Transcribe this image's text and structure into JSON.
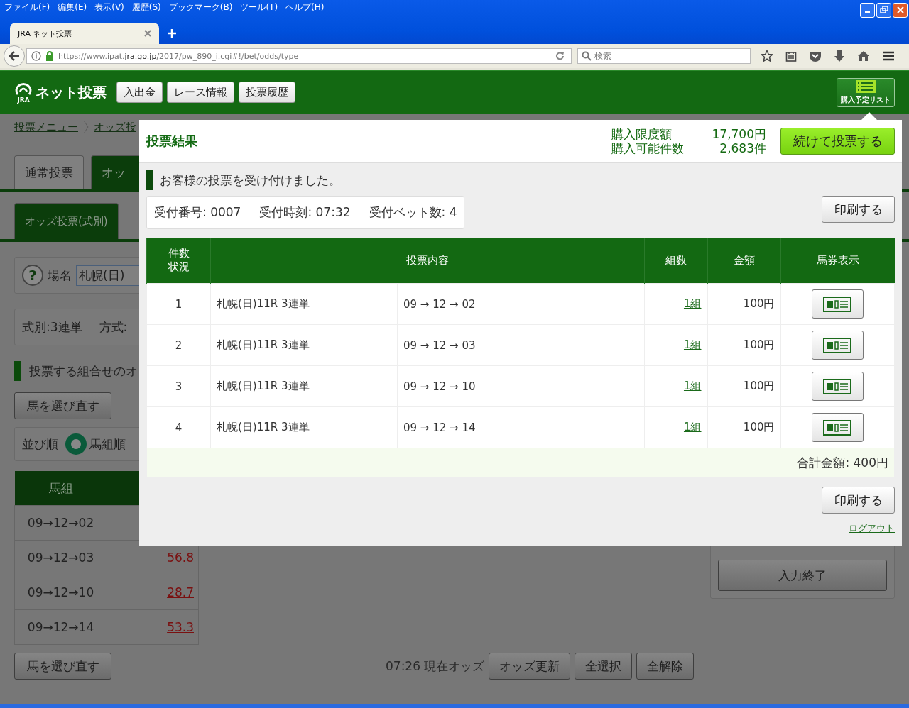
{
  "browser": {
    "menu": [
      "ファイル(F)",
      "編集(E)",
      "表示(V)",
      "履歴(S)",
      "ブックマーク(B)",
      "ツール(T)",
      "ヘルプ(H)"
    ],
    "tab_title": "JRA  ネット投票",
    "url": "https://www.ipat.**jra.go.jp**/2017/pw_890_i.cgi#!/bet/odds/type",
    "search_placeholder": "検索"
  },
  "site_header": {
    "logo_mark": "JRA",
    "logo_text": "ネット投票",
    "nav": [
      "入出金",
      "レース情報",
      "投票履歴"
    ],
    "list_button": "購入予定リスト"
  },
  "background": {
    "breadcrumb": [
      "投票メニュー",
      "オッズ投"
    ],
    "tabs": [
      {
        "label": "通常投票",
        "selected": false
      },
      {
        "label": "オッ",
        "selected": true
      }
    ],
    "subtabs": [
      {
        "label": "オッズ投票(式別)",
        "selected": true
      }
    ],
    "help_icon": "?",
    "venue": {
      "label": "場名",
      "value": "札幌(日)"
    },
    "bet_info": [
      "式別:3連単",
      "方式:"
    ],
    "section_title": "投票する組合せのオ",
    "reselect_button": "馬を選び直す",
    "sort": {
      "label": "並び順",
      "options": [
        {
          "label": "馬組順",
          "selected": true
        }
      ]
    },
    "odds_table": {
      "columns": [
        "馬組"
      ],
      "rows": [
        {
          "combo": "09→12→02"
        },
        {
          "combo": "09→12→03",
          "odds": "56.8"
        },
        {
          "combo": "09→12→10",
          "odds": "28.7"
        },
        {
          "combo": "09→12→14",
          "odds": "53.3"
        }
      ]
    },
    "reselect_button_bottom": "馬を選び直す",
    "odds_time": "07:26 現在オッズ",
    "odds_buttons": [
      "オッズ更新",
      "全選択",
      "全解除"
    ],
    "finish_button": "入力終了"
  },
  "modal": {
    "title": "投票結果",
    "limits": [
      {
        "label": "購入限度額",
        "value": "17,700円"
      },
      {
        "label": "購入可能件数",
        "value": "2,683件"
      }
    ],
    "continue_button": "続けて投票する",
    "message": "お客様の投票を受け付けました。",
    "receipt": [
      "受付番号: 0007",
      "受付時刻: 07:32",
      "受付ベット数: 4"
    ],
    "print_button": "印刷する",
    "table": {
      "columns": [
        "件数状況",
        "投票内容",
        "組数",
        "金額",
        "馬券表示"
      ],
      "rows": [
        {
          "no": "1",
          "race": "札幌(日)11R 3連単",
          "combination": "09 → 12 → 02",
          "sets": "1組",
          "amount": "100円"
        },
        {
          "no": "2",
          "race": "札幌(日)11R 3連単",
          "combination": "09 → 12 → 03",
          "sets": "1組",
          "amount": "100円"
        },
        {
          "no": "3",
          "race": "札幌(日)11R 3連単",
          "combination": "09 → 12 → 10",
          "sets": "1組",
          "amount": "100円"
        },
        {
          "no": "4",
          "race": "札幌(日)11R 3連単",
          "combination": "09 → 12 → 14",
          "sets": "1組",
          "amount": "100円"
        }
      ],
      "total": "合計金額: 400円"
    },
    "print_button_bottom": "印刷する",
    "logout": "ログアウト"
  }
}
